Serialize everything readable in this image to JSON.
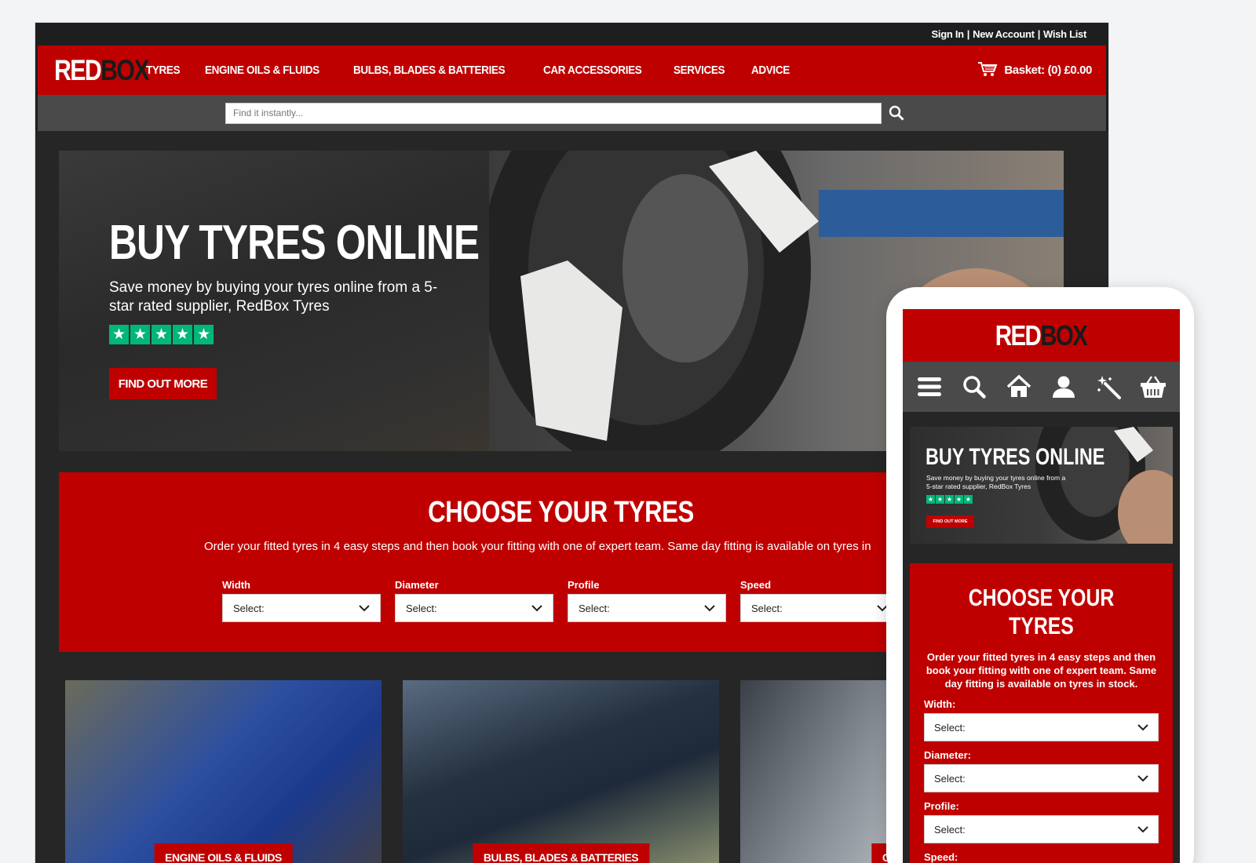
{
  "desktop": {
    "account_links": [
      "Sign In",
      "New Account",
      "Wish List"
    ],
    "logo": {
      "part1": "RED",
      "part2": "BOX"
    },
    "nav": [
      "TYRES",
      "ENGINE OILS & FLUIDS",
      "BULBS, BLADES & BATTERIES",
      "CAR ACCESSORIES",
      "SERVICES",
      "ADVICE"
    ],
    "basket": {
      "label": "Basket:",
      "value": "(0) £0.00",
      "icon": "cart-icon"
    },
    "search": {
      "placeholder": "Find it instantly...",
      "icon": "search-icon"
    },
    "hero": {
      "title": "BUY TYRES ONLINE",
      "subtitle": "Save money by buying your tyres online from a 5-star rated supplier, RedBox Tyres",
      "rating": 5,
      "button": "FIND OUT MORE"
    },
    "tyre_finder": {
      "title": "CHOOSE YOUR TYRES",
      "description": "Order your fitted tyres in 4 easy steps and then book your fitting with one of expert team. Same day fitting is available on tyres in",
      "fields": [
        {
          "label": "Width",
          "value": "Select:"
        },
        {
          "label": "Diameter",
          "value": "Select:"
        },
        {
          "label": "Profile",
          "value": "Select:"
        },
        {
          "label": "Speed",
          "value": "Select:"
        }
      ]
    },
    "categories": [
      "ENGINE OILS & FLUIDS",
      "BULBS, BLADES & BATTERIES",
      "CAR A"
    ]
  },
  "mobile": {
    "logo": {
      "part1": "RED",
      "part2": "BOX"
    },
    "icons": [
      "menu-icon",
      "search-icon",
      "home-icon",
      "user-icon",
      "wand-icon",
      "basket-icon"
    ],
    "hero": {
      "title": "BUY TYRES ONLINE",
      "subtitle": "Save money by buying your tyres online from a 5-star rated supplier, RedBox Tyres",
      "rating": 5,
      "button": "FIND OUT MORE"
    },
    "tyre_finder": {
      "title": "CHOOSE YOUR TYRES",
      "description": "Order your fitted tyres in 4 easy steps and then book your fitting with one of expert team. Same day fitting is available on tyres in stock.",
      "fields": [
        {
          "label": "Width:",
          "value": "Select:"
        },
        {
          "label": "Diameter:",
          "value": "Select:"
        },
        {
          "label": "Profile:",
          "value": "Select:"
        },
        {
          "label": "Speed:",
          "value": ""
        }
      ]
    }
  },
  "colors": {
    "brand_red": "#bf0000",
    "dark": "#262626",
    "bar_grey": "#4a4a4a",
    "trustpilot_green": "#00b67a"
  }
}
